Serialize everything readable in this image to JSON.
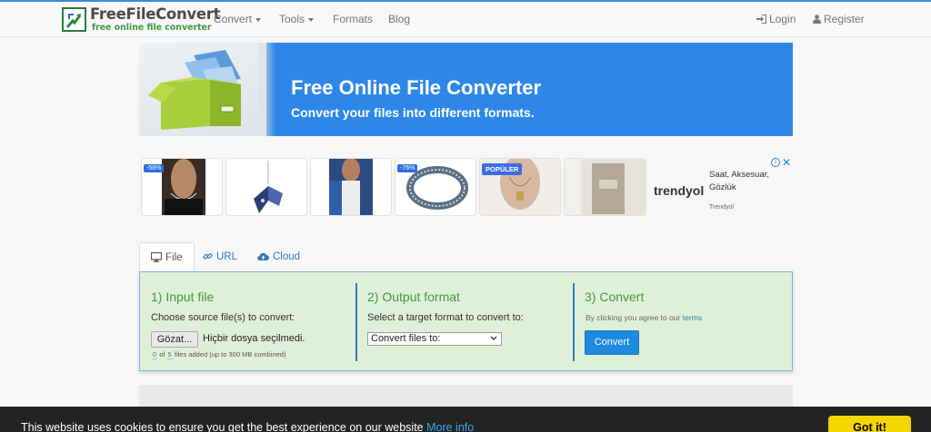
{
  "brand": {
    "title": "FreeFileConvert",
    "subtitle": "free online file converter"
  },
  "nav": {
    "items": [
      "Convert",
      "Tools",
      "Formats",
      "Blog"
    ],
    "login": "Login",
    "register": "Register"
  },
  "banner": {
    "title": "Free Online File Converter",
    "subtitle": "Convert your files into different formats."
  },
  "ad": {
    "badges": [
      "-58%",
      "-76%"
    ],
    "tag": "POPÜLER",
    "brand_name": "trendyol",
    "desc_line1": "Saat, Aksesuar,",
    "desc_line2": "Gözlük",
    "footer": "Trendyol",
    "info_icon": "info-icon",
    "close_icon": "close-icon"
  },
  "tabs": [
    {
      "label": "File",
      "icon": "monitor-icon"
    },
    {
      "label": "URL",
      "icon": "link-icon"
    },
    {
      "label": "Cloud",
      "icon": "cloud-upload-icon"
    }
  ],
  "steps": {
    "input": {
      "title": "1) Input file",
      "text": "Choose source file(s) to convert:",
      "button": "Gözat...",
      "no_file": "Hiçbir dosya seçilmedi.",
      "count": "0",
      "of": "of",
      "max": "5",
      "added_note": "files added (up to 300 MB combined)"
    },
    "output": {
      "title": "2) Output format",
      "text": "Select a target format to convert to:",
      "select_value": "Convert files to:"
    },
    "convert": {
      "title": "3) Convert",
      "agree": "By clicking you agree to our",
      "terms": "terms",
      "button": "Convert"
    }
  },
  "cookie": {
    "text": "This website uses cookies to ensure you get the best experience on our website",
    "more": "More info",
    "button": "Got it!"
  },
  "colors": {
    "accent": "#2e87e8",
    "panel_bg": "#dff0d8",
    "step_title": "#3f9a3c",
    "cookie_btn": "#f1d600"
  }
}
